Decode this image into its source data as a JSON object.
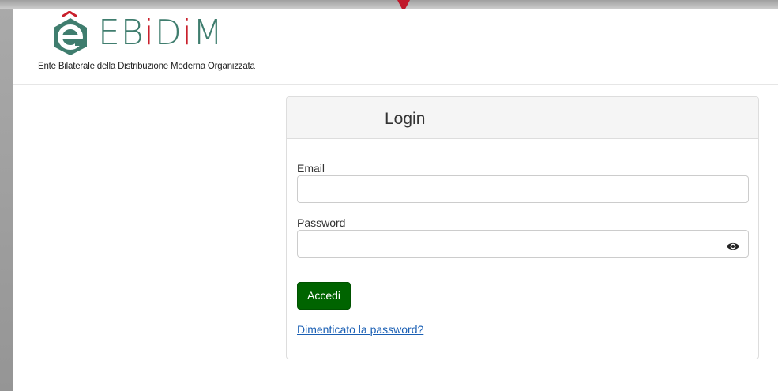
{
  "logo": {
    "word_green_1": "EB",
    "word_red_1": "i",
    "word_green_2": "D",
    "word_red_2": "i",
    "word_green_3": "M",
    "tagline": "Ente Bilaterale della Distribuzione Moderna Organizzata",
    "colors": {
      "green": "#3f7d6e",
      "red": "#c9202c"
    }
  },
  "login": {
    "title": "Login",
    "email_label": "Email",
    "email_value": "",
    "password_label": "Password",
    "password_value": "",
    "password_toggle_icon": "eye-icon",
    "submit_label": "Accedi",
    "forgot_link": "Dimenticato la password?"
  },
  "colors": {
    "button": "#006400",
    "link": "#1a5fb4",
    "panel_heading": "#f5f5f5"
  }
}
